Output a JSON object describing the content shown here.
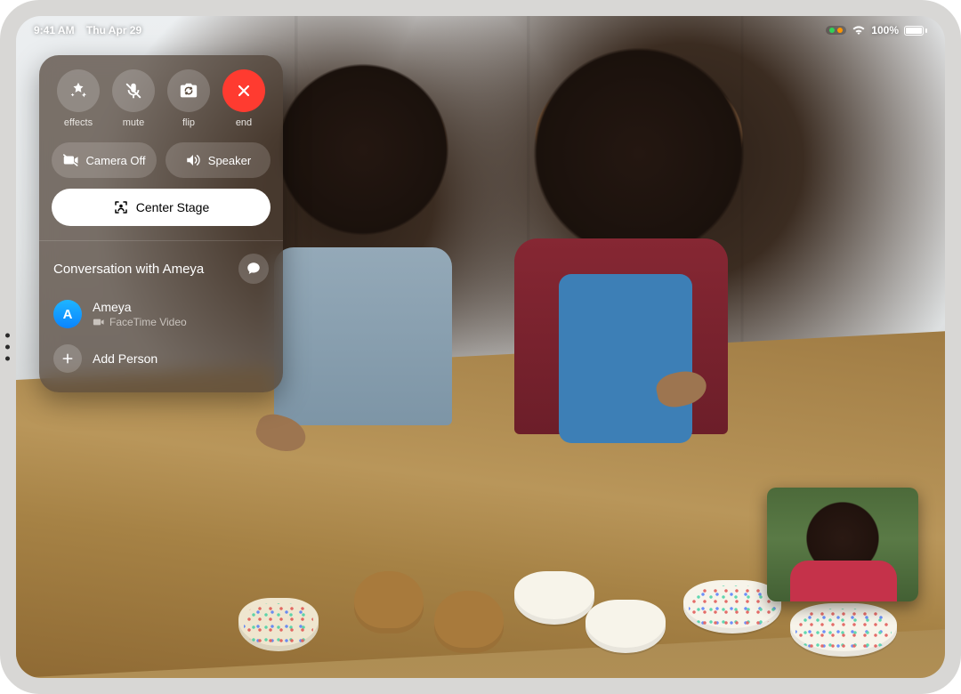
{
  "status": {
    "time": "9:41 AM",
    "date": "Thu Apr 29",
    "battery_pct": "100%"
  },
  "controls": {
    "effects": "effects",
    "mute": "mute",
    "flip": "flip",
    "end": "end",
    "camera_off": "Camera Off",
    "speaker": "Speaker",
    "center_stage": "Center Stage"
  },
  "conversation": {
    "title": "Conversation with Ameya",
    "participant": {
      "initial": "A",
      "name": "Ameya",
      "sub": "FaceTime Video"
    },
    "add_person": "Add Person"
  }
}
